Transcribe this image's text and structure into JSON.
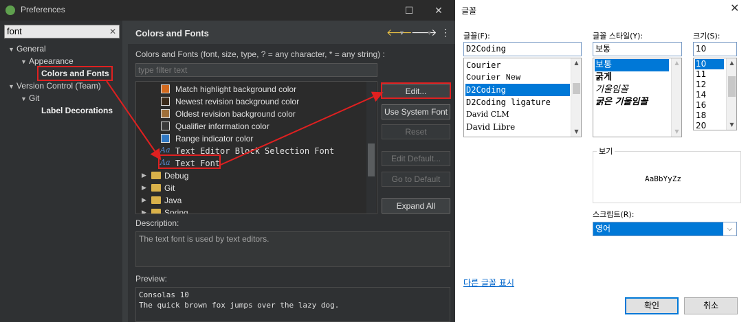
{
  "prefs": {
    "title": "Preferences",
    "filter_value": "font",
    "tree": [
      {
        "label": "General"
      },
      {
        "label": "Appearance"
      },
      {
        "label": "Colors and Fonts"
      },
      {
        "label": "Version Control (Team)"
      },
      {
        "label": "Git"
      },
      {
        "label": "Label Decorations"
      }
    ],
    "page_title": "Colors and Fonts",
    "page_desc": "Colors and Fonts (font, size, type, ? = any character, * = any string) :",
    "type_filter_placeholder": "type filter text",
    "rows": [
      {
        "label": "Match highlight background color",
        "color": "#d2691e"
      },
      {
        "label": "Newest revision background color",
        "color": "#3a2a1a"
      },
      {
        "label": "Oldest revision background color",
        "color": "#a0703a"
      },
      {
        "label": "Qualifier information color",
        "color": "#3a3a3a"
      },
      {
        "label": "Range indicator color",
        "color": "#2f78c4"
      }
    ],
    "font_rows": [
      "Text Editor Block Selection Font",
      "Text Font"
    ],
    "categories": [
      "Debug",
      "Git",
      "Java",
      "Spring"
    ],
    "buttons": {
      "edit": "Edit...",
      "use_system_font": "Use System Font",
      "reset": "Reset",
      "edit_default": "Edit Default...",
      "go_to_default": "Go to Default",
      "expand_all": "Expand All"
    },
    "description_label": "Description:",
    "description_text": "The text font is used by text editors.",
    "preview_label": "Preview:",
    "preview_line1": "Consolas 10",
    "preview_line2": "The quick brown fox jumps over the lazy dog."
  },
  "font_dialog": {
    "title": "글꼴",
    "font_label": "글꼴(F):",
    "font_value": "D2Coding",
    "fonts": [
      "Courier",
      "Courier New",
      "D2Coding",
      "D2Coding ligature",
      "David CLM",
      "David Libre"
    ],
    "selected_font_index": 2,
    "style_label": "글꼴 스타일(Y):",
    "style_value": "보통",
    "styles": [
      "보통",
      "굵게",
      "기울임꼴",
      "굵은 기울임꼴"
    ],
    "size_label": "크기(S):",
    "size_value": "10",
    "sizes": [
      "10",
      "11",
      "12",
      "14",
      "16",
      "18",
      "20"
    ],
    "sample_label": "보기",
    "sample_text": "AaBbYyZz",
    "script_label": "스크립트(R):",
    "script_value": "영어",
    "more_fonts_link": "다른 글꼴 표시",
    "ok": "확인",
    "cancel": "취소"
  },
  "colors": {
    "highlight_red": "#e02020",
    "selection_blue": "#0078d7",
    "dark_bg": "#2f3133"
  }
}
